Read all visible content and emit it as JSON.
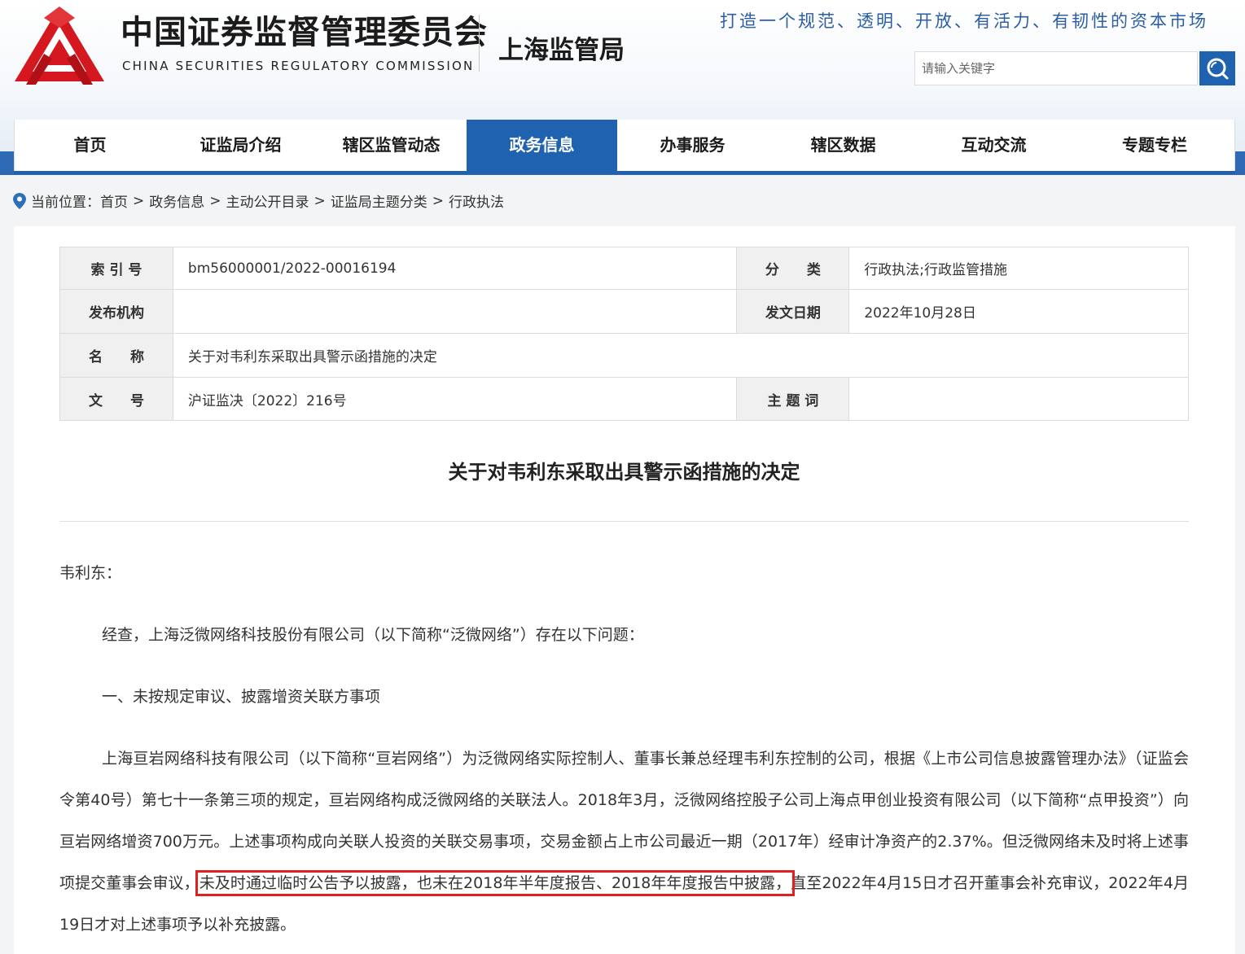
{
  "header": {
    "org_name_cn": "中国证券监督管理委员会",
    "org_name_en": "CHINA SECURITIES REGULATORY COMMISSION",
    "bureau": "上海监管局",
    "slogan": "打造一个规范、透明、开放、有活力、有韧性的资本市场",
    "search_placeholder": "请输入关键字",
    "logo_icon": "csrc-logo-icon",
    "search_icon": "search-icon",
    "brand_red": "#d5171f",
    "brand_blue": "#1f62b0"
  },
  "nav": {
    "items": [
      {
        "label": "首页"
      },
      {
        "label": "证监局介绍"
      },
      {
        "label": "辖区监管动态"
      },
      {
        "label": "政务信息",
        "active": true
      },
      {
        "label": "办事服务"
      },
      {
        "label": "辖区数据"
      },
      {
        "label": "互动交流"
      },
      {
        "label": "专题专栏"
      }
    ]
  },
  "breadcrumb": {
    "prefix": "当前位置：",
    "items": [
      "首页",
      "政务信息",
      "主动公开目录",
      "证监局主题分类",
      "行政执法"
    ],
    "separator": ">"
  },
  "meta": {
    "index_label": "索 引 号",
    "index_value": "bm56000001/2022-00016194",
    "category_label": "分　　类",
    "category_value": "行政执法;行政监管措施",
    "publisher_label": "发布机构",
    "publisher_value": "",
    "date_label": "发文日期",
    "date_value": "2022年10月28日",
    "name_label": "名　　称",
    "name_value": "关于对韦利东采取出具警示函措施的决定",
    "docno_label": "文　　号",
    "docno_value": "沪证监决〔2022〕216号",
    "keywords_label": "主 题 词",
    "keywords_value": ""
  },
  "article": {
    "title": "关于对韦利东采取出具警示函措施的决定",
    "salutation": "韦利东：",
    "p1": "经查，上海泛微网络科技股份有限公司（以下简称“泛微网络”）存在以下问题：",
    "h1": "一、未按规定审议、披露增资关联方事项",
    "p2_before": "上海亘岩网络科技有限公司（以下简称“亘岩网络”）为泛微网络实际控制人、董事长兼总经理韦利东控制的公司，根据《上市公司信息披露管理办法》（证监会令第40号）第七十一条第三项的规定，亘岩网络构成泛微网络的关联法人。2018年3月，泛微网络控股子公司上海点甲创业投资有限公司（以下简称“点甲投资”）向亘岩网络增资700万元。上述事项构成向关联人投资的关联交易事项，交易金额占上市公司最近一期（2017年）经审计净资产的2.37%。但泛微网络未及时将上述事项提交董事会审议，",
    "p2_highlight": "未及时通过临时公告予以披露，也未在2018年半年度报告、2018年年度报告中披露，",
    "p2_after": "直至2022年4月15日才召开董事会补充审议，2022年4月19日才对上述事项予以补充披露。",
    "highlight_color": "#e02020"
  }
}
